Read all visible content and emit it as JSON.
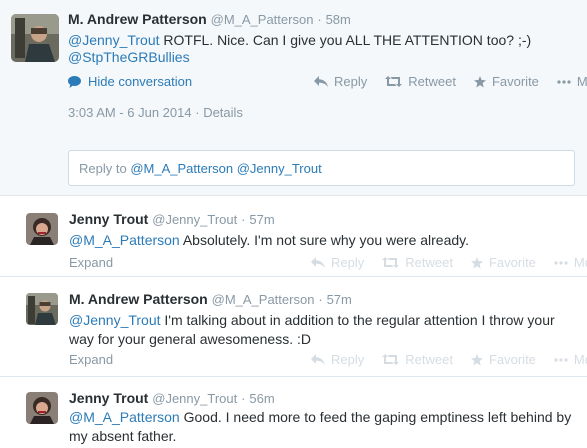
{
  "main_tweet": {
    "name": "M. Andrew Patterson",
    "handle": "@M_A_Patterson",
    "time": "58m",
    "mention": "@Jenny_Trout",
    "text": " ROTFL. Nice. Can I give you ALL THE ATTENTION too? ;-)",
    "hashtag": "@StpTheGRBullies",
    "hide_conversation": "Hide conversation",
    "timestamp": "3:03 AM - 6 Jun 2014",
    "details": "Details",
    "actions": {
      "reply": "Reply",
      "retweet": "Retweet",
      "favorite": "Favorite",
      "more": "More"
    }
  },
  "reply_box": {
    "prefix": "Reply to ",
    "mentions": "@M_A_Patterson @Jenny_Trout"
  },
  "replies": [
    {
      "name": "Jenny Trout",
      "handle": "@Jenny_Trout",
      "time": "57m",
      "mention": "@M_A_Patterson",
      "text": " Absolutely. I'm not sure why you were already.",
      "expand": "Expand"
    },
    {
      "name": "M. Andrew Patterson",
      "handle": "@M_A_Patterson",
      "time": "57m",
      "mention": "@Jenny_Trout",
      "text": " I'm talking about in addition to the regular attention I throw your way for your general awesomeness. :D",
      "expand": "Expand"
    },
    {
      "name": "Jenny Trout",
      "handle": "@Jenny_Trout",
      "time": "56m",
      "mention": "@M_A_Patterson",
      "text": " Good. I need more to feed the gaping emptiness left behind by my absent father."
    }
  ],
  "icons": [
    "speech-bubble-icon",
    "reply-icon",
    "retweet-icon",
    "star-icon",
    "ellipsis-icon"
  ]
}
